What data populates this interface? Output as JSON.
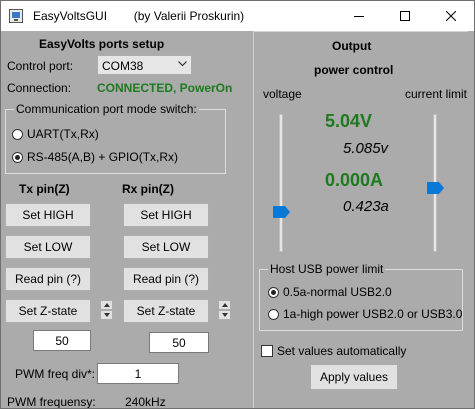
{
  "window": {
    "title": "EasyVoltsGUI        (by Valerii Proskurin)",
    "minimize": "–",
    "maximize": "☐",
    "close": "✕",
    "icon": "app-icon"
  },
  "setup": {
    "title": "EasyVolts ports setup",
    "control_port_label": "Control port:",
    "control_port_value": "COM38",
    "connection_label": "Connection:",
    "connection_status": "CONNECTED, PowerOn",
    "connection_status_color": "#1e7a1e"
  },
  "mode_group": {
    "legend": "Communication port mode switch:",
    "options": [
      {
        "label": "UART(Tx,Rx)",
        "selected": false
      },
      {
        "label": "RS-485(A,B) + GPIO(Tx,Rx)",
        "selected": true
      }
    ]
  },
  "tx": {
    "heading": "Tx pin(Z)",
    "set_high": "Set HIGH",
    "set_low": "Set LOW",
    "read_pin": "Read pin (?)",
    "set_z": "Set Z-state",
    "value": "50"
  },
  "rx": {
    "heading": "Rx pin(Z)",
    "set_high": "Set HIGH",
    "set_low": "Set LOW",
    "read_pin": "Read pin (?)",
    "set_z": "Set Z-state",
    "value": "50"
  },
  "pwm": {
    "div_label": "PWM freq div*:",
    "div_value": "1",
    "freq_label": "PWM frequensy:",
    "freq_value": "240kHz"
  },
  "output": {
    "title": "Output",
    "subtitle": "power control",
    "voltage_label": "voltage",
    "current_label": "current limit",
    "set_voltage": "5.04V",
    "measured_voltage": "5.085v",
    "set_current": "0.000A",
    "measured_current": "0.423a",
    "voltage_slider_level": 0.42,
    "current_slider_level": 0.42,
    "thumb_color": "#0a78d7",
    "value_color": "#1e7a1e"
  },
  "usb_group": {
    "legend": "Host USB power limit",
    "options": [
      {
        "label": "0.5a-normal USB2.0",
        "selected": true
      },
      {
        "label": "1a-high power USB2.0 or USB3.0",
        "selected": false
      }
    ]
  },
  "auto": {
    "checkbox_label": "Set values automatically",
    "checked": false,
    "apply_button": "Apply values"
  }
}
